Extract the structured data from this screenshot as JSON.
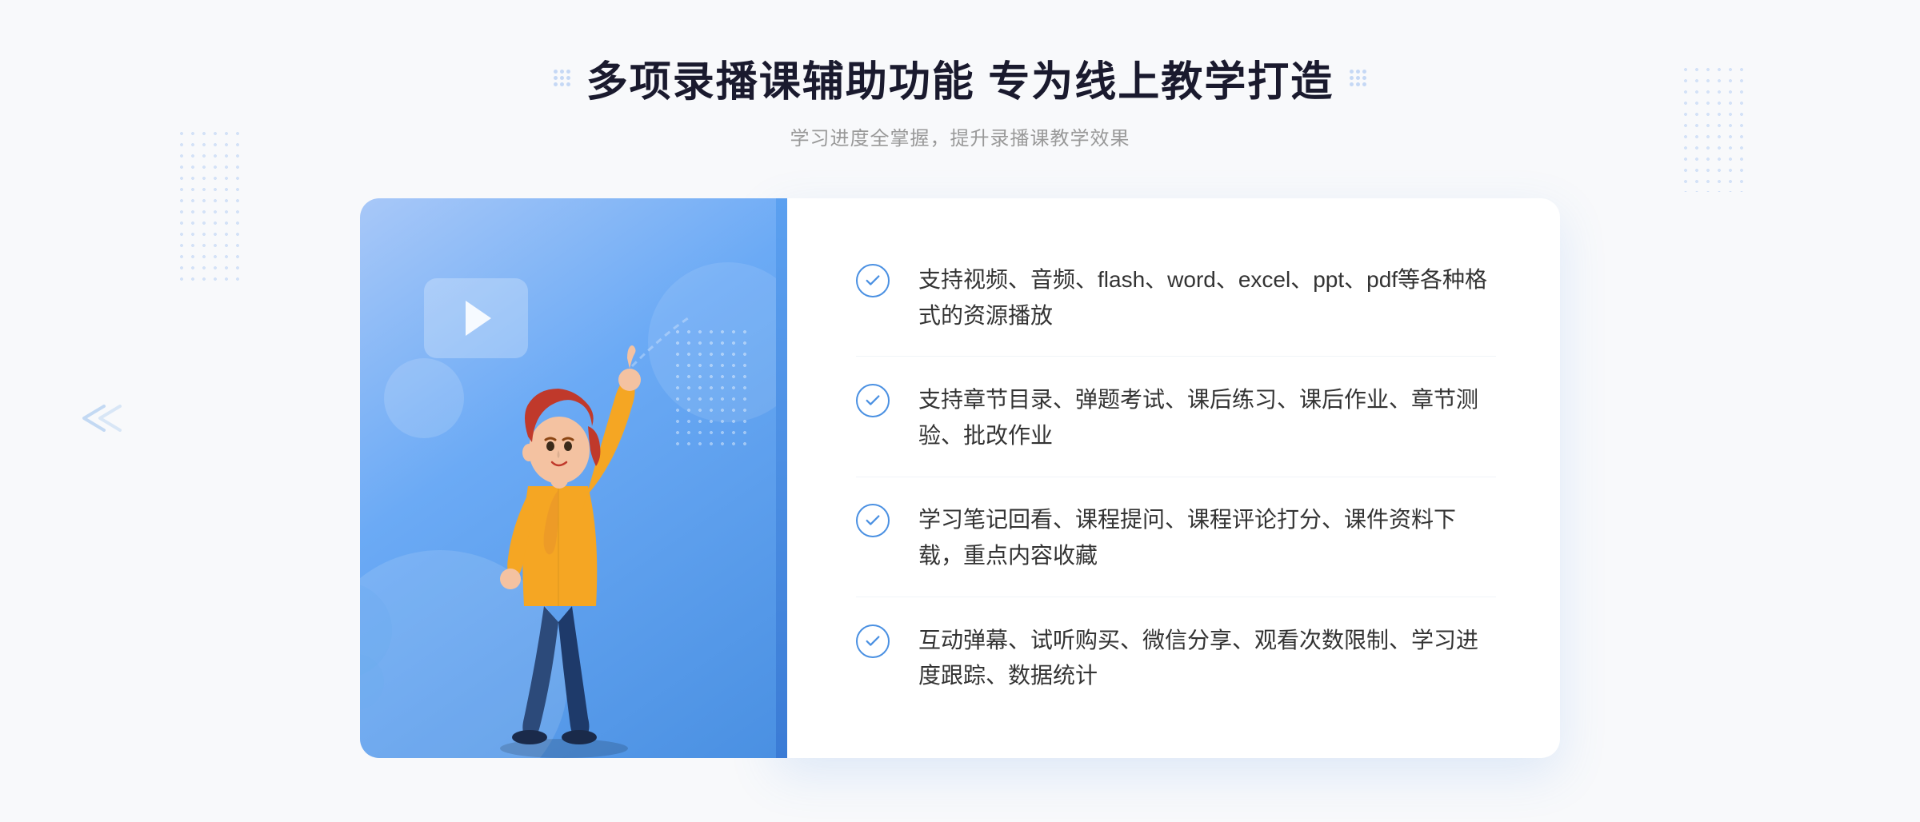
{
  "page": {
    "background_color": "#f8f9fb"
  },
  "header": {
    "title": "多项录播课辅助功能 专为线上教学打造",
    "subtitle": "学习进度全掌握，提升录播课教学效果",
    "dots_icon": "grid-dots-icon"
  },
  "features": [
    {
      "id": 1,
      "text": "支持视频、音频、flash、word、excel、ppt、pdf等各种格式的资源播放"
    },
    {
      "id": 2,
      "text": "支持章节目录、弹题考试、课后练习、课后作业、章节测验、批改作业"
    },
    {
      "id": 3,
      "text": "学习笔记回看、课程提问、课程评论打分、课件资料下载，重点内容收藏"
    },
    {
      "id": 4,
      "text": "互动弹幕、试听购买、微信分享、观看次数限制、学习进度跟踪、数据统计"
    }
  ],
  "illustration": {
    "play_button": "▶",
    "accent_color": "#4a90e2"
  }
}
